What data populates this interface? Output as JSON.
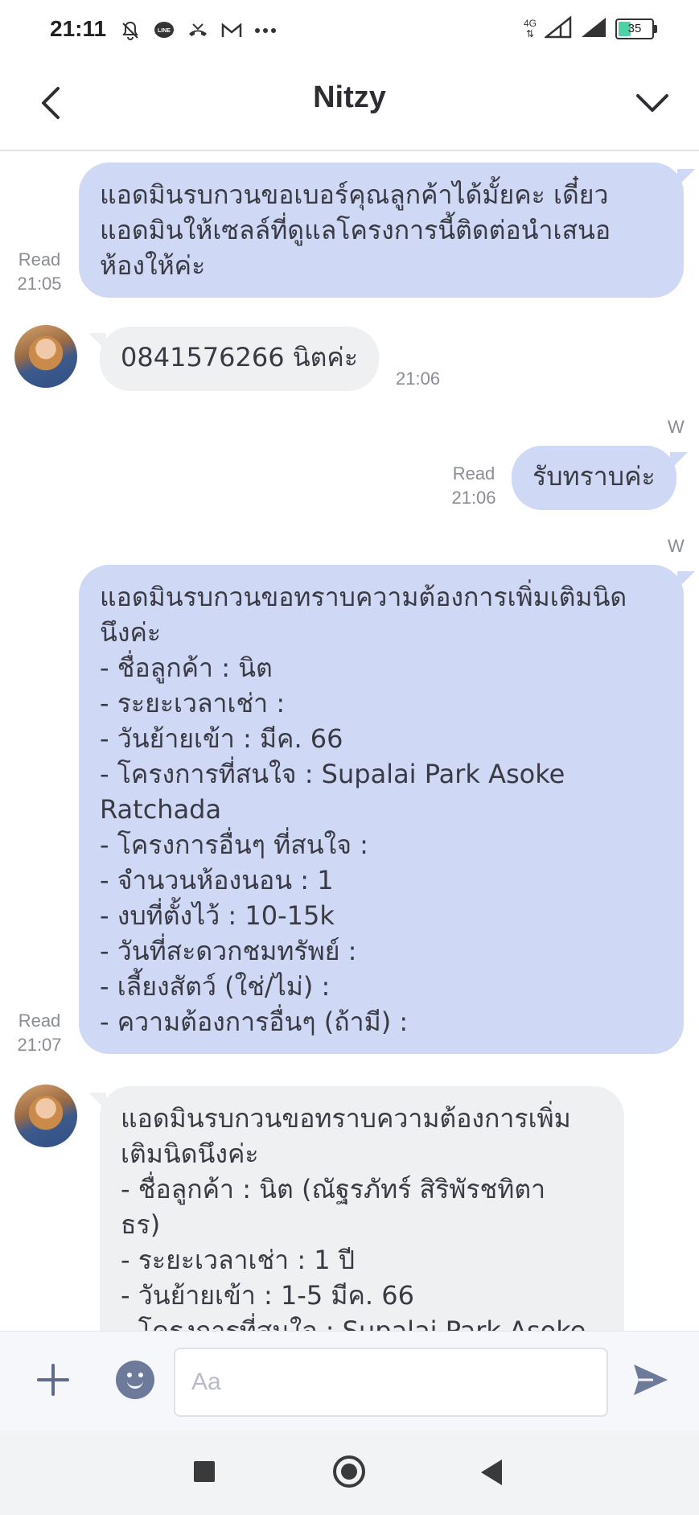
{
  "status_bar": {
    "time": "21:11",
    "network": "4G",
    "battery": "35",
    "icons": [
      "bell-off-icon",
      "line-app-icon",
      "missed-call-icon",
      "gmail-icon",
      "more-icon",
      "signal-icon",
      "signal-icon",
      "battery-icon"
    ]
  },
  "header": {
    "title": "Nitzy"
  },
  "messages": [
    {
      "direction": "out",
      "lines": [
        "แอดมินรบกวนขอเบอร์คุณลูกค้าได้มั้ยคะ เดี๋ยว",
        "แอดมินให้เซลล์ที่ดูแลโครงการนี้ติดต่อนำเสนอ",
        "ห้องให้ค่ะ"
      ],
      "status": "Read",
      "time": "21:05"
    },
    {
      "direction": "in",
      "lines": [
        "0841576266 นิตค่ะ"
      ],
      "time": "21:06"
    },
    {
      "direction": "out",
      "sender_mark": "W",
      "lines": [
        "รับทราบค่ะ"
      ],
      "status": "Read",
      "time": "21:06"
    },
    {
      "direction": "out",
      "sender_mark": "W",
      "lines": [
        "แอดมินรบกวนขอทราบความต้องการเพิ่มเติมนิด",
        "นึงค่ะ",
        "- ชื่อลูกค้า : นิต",
        "- ระยะเวลาเช่า :",
        "- วันย้ายเข้า : มีค. 66",
        "- โครงการที่สนใจ : Supalai Park Asoke",
        "Ratchada",
        "- โครงการอื่นๆ ที่สนใจ :",
        "- จำนวนห้องนอน : 1",
        "- งบที่ตั้งไว้ : 10-15k",
        "- วันที่สะดวกชมทรัพย์ :",
        "- เลี้ยงสัตว์ (ใช่/ไม่) :",
        "- ความต้องการอื่นๆ (ถ้ามี) :"
      ],
      "status": "Read",
      "time": "21:07"
    },
    {
      "direction": "in",
      "lines": [
        "แอดมินรบกวนขอทราบความต้องการเพิ่ม",
        "เติมนิดนึงค่ะ",
        "- ชื่อลูกค้า : นิต (ณัฐรภัทร์ สิริพัรชทิตา",
        "ธร)",
        "- ระยะเวลาเช่า : 1 ปี",
        "- วันย้ายเข้า : 1-5 มีค. 66",
        "- โครงการที่สนใจ : Supalai Park Asoke"
      ]
    }
  ],
  "composer": {
    "placeholder": "Aa"
  }
}
